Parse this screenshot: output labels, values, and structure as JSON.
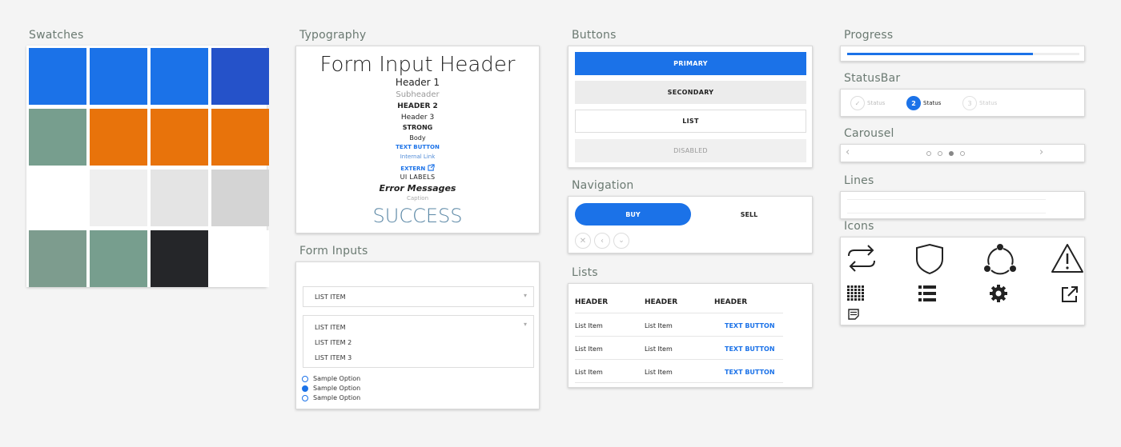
{
  "sections": {
    "swatches": "Swatches",
    "typography": "Typography",
    "buttons": "Buttons",
    "navigation": "Navigation",
    "lists": "Lists",
    "form_inputs": "Form Inputs",
    "progress": "Progress",
    "statusbar": "StatusBar",
    "carousel": "Carousel",
    "lines": "Lines",
    "icons": "Icons"
  },
  "swatch_colors": [
    "#1b72e8",
    "#1b72e8",
    "#1b72e8",
    "#2552c9",
    "#779e8e",
    "#e8730b",
    "#e8730b",
    "#e8730b",
    "#ffffff",
    "#efefef",
    "#e4e4e4",
    "#d4d4d4",
    "#7d9c8e",
    "#779e8e",
    "#252629",
    "#ffffff"
  ],
  "typography": {
    "form_input_header": "Form Input Header",
    "header1": "Header 1",
    "subheader": "Subheader",
    "header2": "HEADER 2",
    "header3": "Header 3",
    "strong": "STRONG",
    "body": "Body",
    "text_button": "TEXT BUTTON",
    "internal_link": "Internal Link",
    "extern": "EXTERN",
    "ui_labels": "UI LABELS",
    "error_messages": "Error Messages",
    "caption": "Caption",
    "success": "SUCCESS"
  },
  "form_inputs": {
    "select_value": "LIST ITEM",
    "open_list": [
      "LIST ITEM",
      "LIST ITEM 2",
      "LIST ITEM 3"
    ],
    "radios": [
      {
        "label": "Sample Option",
        "checked": false
      },
      {
        "label": "Sample Option",
        "checked": true
      },
      {
        "label": "Sample Option",
        "checked": false
      }
    ]
  },
  "buttons": {
    "primary": "PRIMARY",
    "secondary": "SECONDARY",
    "list": "LIST",
    "disabled": "DISABLED"
  },
  "navigation": {
    "buy": "BUY",
    "sell": "SELL",
    "icons": [
      "close-icon",
      "chevron-left-icon",
      "chevron-down-icon"
    ]
  },
  "lists": {
    "headers": [
      "HEADER",
      "HEADER",
      "HEADER"
    ],
    "rows": [
      [
        "List Item",
        "List Item",
        "TEXT BUTTON"
      ],
      [
        "List Item",
        "List Item",
        "TEXT BUTTON"
      ],
      [
        "List Item",
        "List Item",
        "TEXT BUTTON"
      ]
    ]
  },
  "progress": {
    "value": 0.8
  },
  "statusbar": {
    "steps": [
      {
        "label": "Status",
        "state": "done",
        "marker": "✓"
      },
      {
        "label": "Status",
        "state": "active",
        "marker": "2"
      },
      {
        "label": "Status",
        "state": "pending",
        "marker": "3"
      }
    ]
  },
  "carousel": {
    "dots": 4,
    "active_index": 2
  },
  "icons": [
    "swap-arrows-icon",
    "shield-icon",
    "sync-nodes-icon",
    "warning-icon",
    "grid-icon",
    "list-icon",
    "gear-icon",
    "external-link-icon",
    "notes-icon"
  ],
  "colors": {
    "accent": "#1b72e8",
    "success": "#5a87a5",
    "section_title": "#6b7a72"
  }
}
